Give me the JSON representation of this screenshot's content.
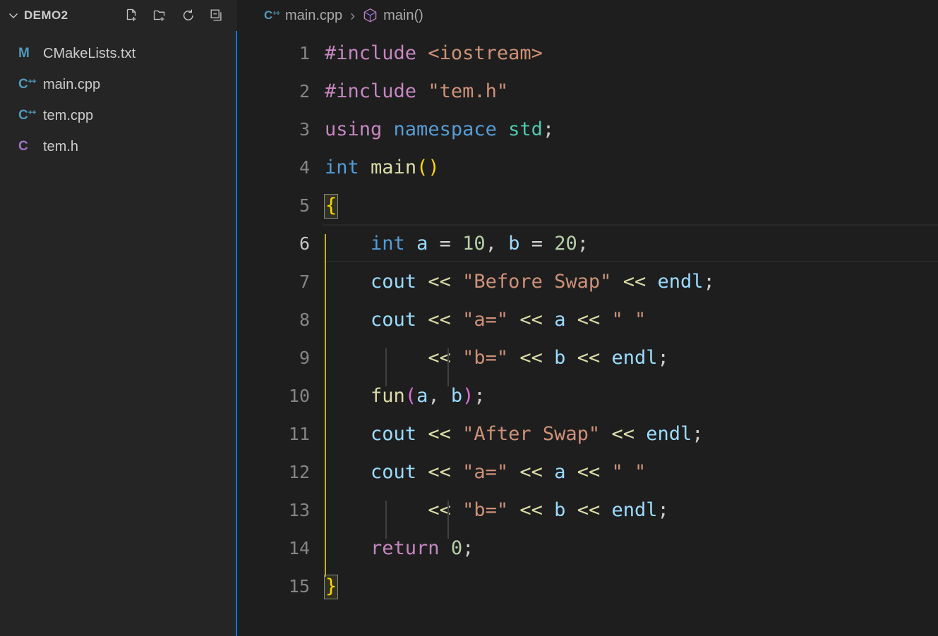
{
  "sidebar": {
    "section_title": "DEMO2",
    "twisty_icon": "chevron-down-icon",
    "actions": [
      {
        "name": "new-file-button",
        "icon": "new-file-icon",
        "tooltip": "New File..."
      },
      {
        "name": "new-folder-button",
        "icon": "new-folder-icon",
        "tooltip": "New Folder..."
      },
      {
        "name": "refresh-button",
        "icon": "refresh-icon",
        "tooltip": "Refresh Explorer"
      },
      {
        "name": "collapse-button",
        "icon": "collapse-all-icon",
        "tooltip": "Collapse Folders in Explorer"
      }
    ],
    "files": [
      {
        "label": "CMakeLists.txt",
        "icon": "M",
        "sup": "",
        "icon_class": "ic-m",
        "icon_name": "cmake-file-icon"
      },
      {
        "label": "main.cpp",
        "icon": "C",
        "sup": "++",
        "icon_class": "ic-cpp",
        "icon_name": "cpp-file-icon"
      },
      {
        "label": "tem.cpp",
        "icon": "C",
        "sup": "++",
        "icon_class": "ic-cpp",
        "icon_name": "cpp-file-icon"
      },
      {
        "label": "tem.h",
        "icon": "C",
        "sup": "",
        "icon_class": "ic-h",
        "icon_name": "c-header-file-icon"
      }
    ]
  },
  "breadcrumb": {
    "file_icon": "cpp-file-icon",
    "file": "main.cpp",
    "separator": "›",
    "symbol_icon": "cube-symbol-icon",
    "symbol": "main()"
  },
  "editor": {
    "language": "cpp",
    "active_line": 6,
    "total_lines": 15,
    "line_numbers": [
      "1",
      "2",
      "3",
      "4",
      "5",
      "6",
      "7",
      "8",
      "9",
      "10",
      "11",
      "12",
      "13",
      "14",
      "15"
    ],
    "lines": [
      "#include <iostream>",
      "#include \"tem.h\"",
      "using namespace std;",
      "int main()",
      "{",
      "    int a = 10, b = 20;",
      "    cout << \"Before Swap\" << endl;",
      "    cout << \"a=\" << a << \" \"",
      "         << \"b=\" << b << endl;",
      "    fun(a, b);",
      "    cout << \"After Swap\" << endl;",
      "    cout << \"a=\" << a << \" \"",
      "         << \"b=\" << b << endl;",
      "    return 0;",
      "}"
    ]
  },
  "colors": {
    "editor_background": "#1e1e1e",
    "sidebar_background": "#252526",
    "focus_border": "#0078d4",
    "line_number": "#858585",
    "active_indent_guide": "#c8b400",
    "indent_guide": "#404040",
    "keyword": "#569cd6",
    "control_keyword": "#c586c0",
    "string": "#ce9178",
    "number": "#b5cea8",
    "variable": "#9cdcfe",
    "function": "#dcdcaa",
    "type": "#4ec9b0",
    "bracket_level_1": "#ffd700",
    "bracket_level_2": "#da70d6",
    "foreground": "#d4d4d4"
  }
}
